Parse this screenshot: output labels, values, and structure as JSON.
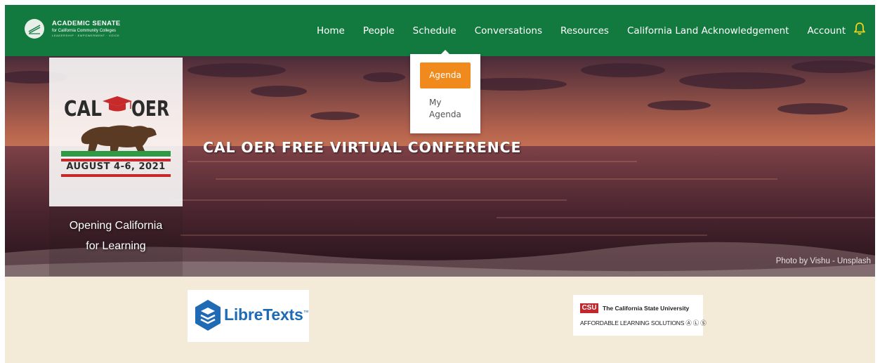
{
  "header": {
    "org_line1": "Academic Senate",
    "org_line2": "for California Community Colleges",
    "org_line3": "LEADERSHIP · EMPOWERMENT · VOICE",
    "nav": [
      "Home",
      "People",
      "Schedule",
      "Conversations",
      "Resources",
      "California Land Acknowledgement",
      "Account"
    ],
    "bell_icon": "bell-icon"
  },
  "schedule_menu": {
    "items": [
      "Agenda",
      "My Agenda"
    ],
    "active": "Agenda"
  },
  "hero": {
    "title": "CAL OER FREE VIRTUAL CONFERENCE",
    "photo_credit": "Photo by Vishu - Unsplash",
    "logo_wordmark": "CAL OER",
    "dates": "AUGUST 4-6, 2021",
    "tagline_line1": "Opening California",
    "tagline_line2": "for Learning"
  },
  "sponsors": {
    "libretexts": "LibreTexts",
    "libretexts_tm": "™",
    "csu_badge": "CSU",
    "csu_name": "The California State University",
    "csu_program": "AFFORDABLE LEARNING SOLUTIONS Ⓐ Ⓛ Ⓢ"
  },
  "colors": {
    "nav_green": "#127a3e",
    "accent_orange": "#f08a1c",
    "bell_yellow": "#f2d21c",
    "sponsor_bg": "#f3ebd8",
    "csu_red": "#c1272d",
    "libretexts_blue": "#1f6ab5"
  }
}
